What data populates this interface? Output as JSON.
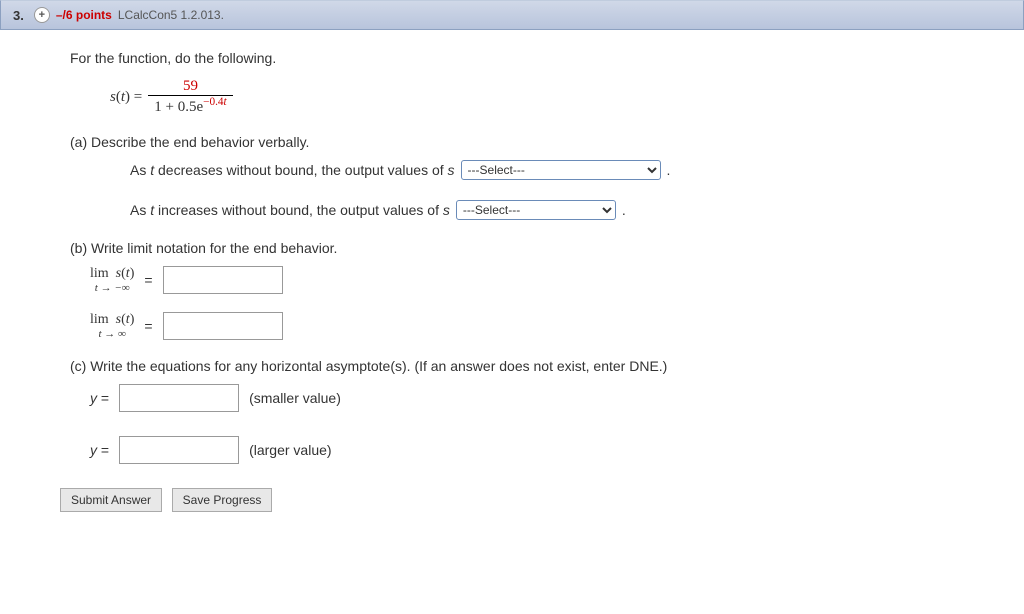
{
  "header": {
    "number": "3.",
    "points_prefix": "–/6 points",
    "source": "LCalcCon5 1.2.013."
  },
  "instruction": "For the function, do the following.",
  "formula": {
    "lhs_var": "s",
    "lhs_arg": "t",
    "numerator": "59",
    "denominator_prefix": "1 + 0.5e",
    "denominator_exponent": "−0.4",
    "denominator_exponent_var": "t"
  },
  "part_a": {
    "label": "(a) Describe the end behavior verbally.",
    "row1_prefix": "As ",
    "row1_var": "t",
    "row1_mid": " decreases without bound, the output values of ",
    "row1_var2": "s",
    "row2_prefix": "As ",
    "row2_var": "t",
    "row2_mid": " increases without bound, the output values of ",
    "row2_var2": "s",
    "select_placeholder": "---Select---",
    "period": "."
  },
  "part_b": {
    "label": "(b) Write limit notation for the end behavior.",
    "lim": "lim",
    "func_var": "s",
    "func_arg": "t",
    "arrow_neg": "t → −∞",
    "arrow_pos": "t → ∞",
    "equals": "="
  },
  "part_c": {
    "label": "(c) Write the equations for any horizontal asymptote(s). (If an answer does not exist, enter DNE.)",
    "y_eq_var": "y",
    "eq": " = ",
    "smaller": "(smaller value)",
    "larger": "(larger value)"
  },
  "buttons": {
    "submit": "Submit Answer",
    "save": "Save Progress"
  }
}
